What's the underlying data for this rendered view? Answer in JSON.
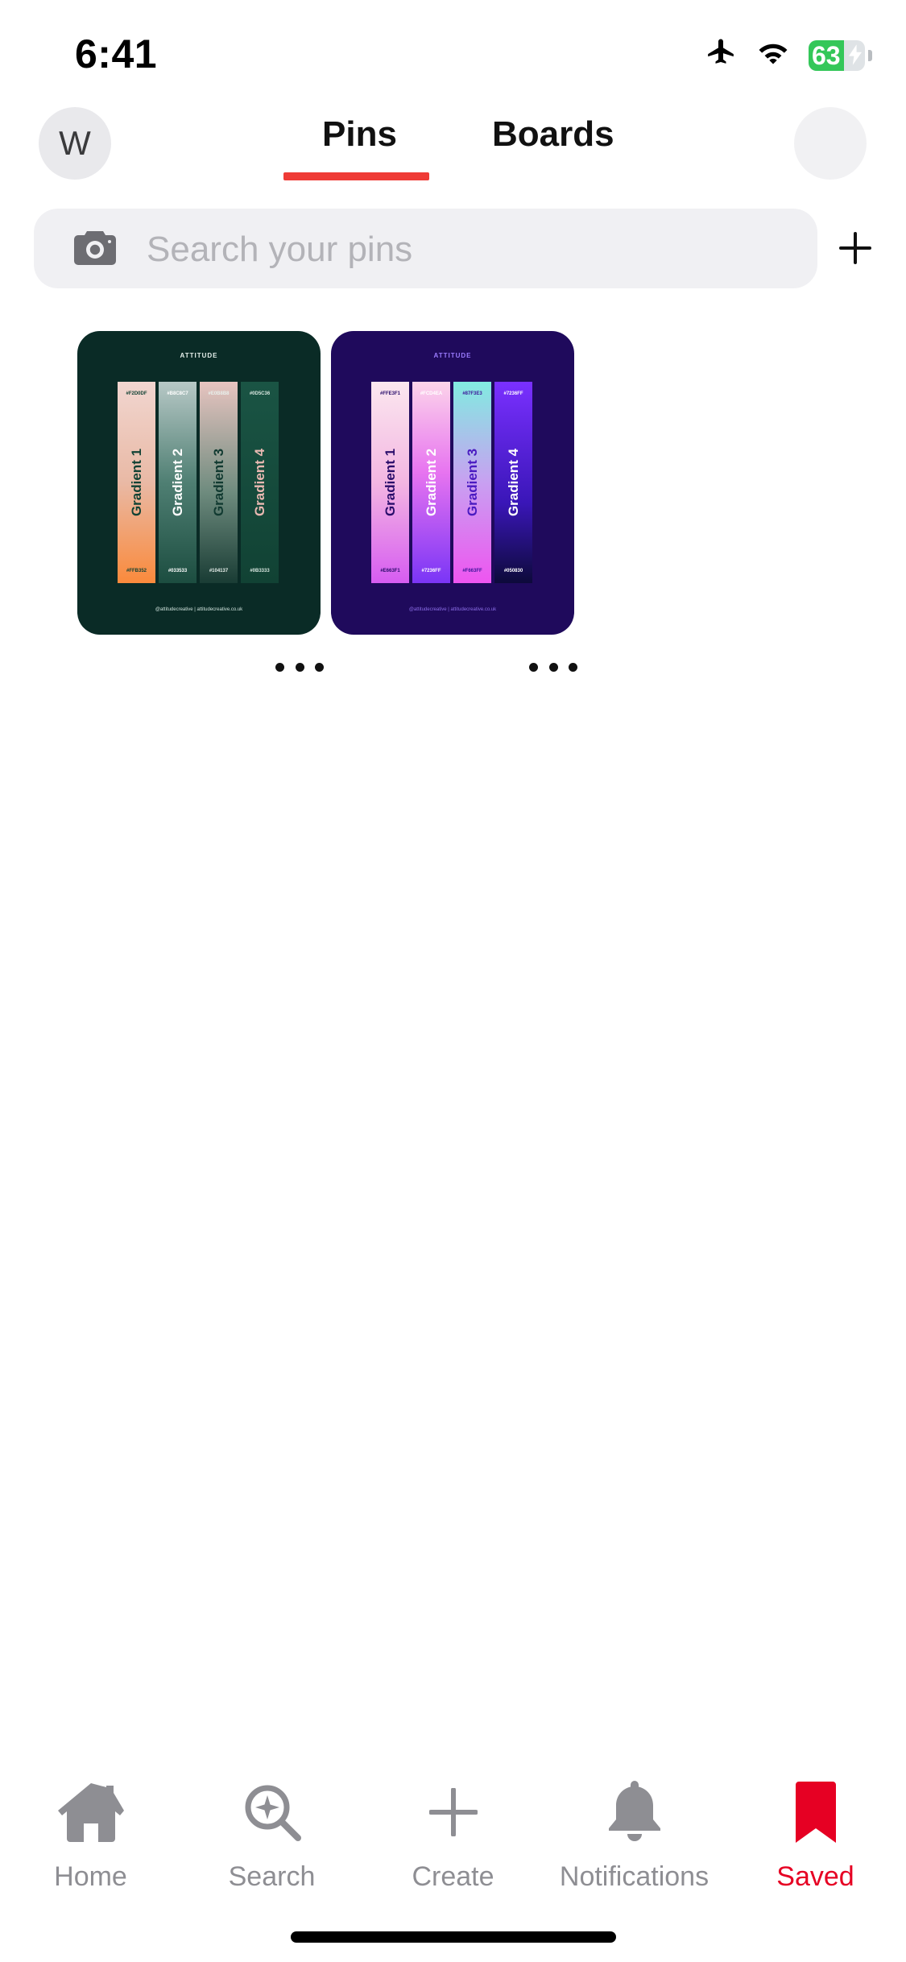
{
  "status_bar": {
    "time": "6:41",
    "battery_level": "63",
    "battery_fraction": 0.63,
    "icons": [
      "airplane-icon",
      "wifi-icon",
      "battery-charging-icon"
    ]
  },
  "header": {
    "avatar_initial": "W",
    "tabs": [
      {
        "label": "Pins",
        "active": true
      },
      {
        "label": "Boards",
        "active": false
      }
    ]
  },
  "search": {
    "placeholder": "Search your pins",
    "value": ""
  },
  "pins": [
    {
      "brand": "ATTITUDE",
      "strips": [
        {
          "label": "Gradient 1",
          "top_code": "#F2D0DF",
          "bottom_code": "#FFB352"
        },
        {
          "label": "Gradient 2",
          "top_code": "#B8C8C7",
          "bottom_code": "#033533"
        },
        {
          "label": "Gradient 3",
          "top_code": "#E0B8B8",
          "bottom_code": "#104137"
        },
        {
          "label": "Gradient 4",
          "top_code": "#0D5C36",
          "bottom_code": "#0B3333"
        }
      ],
      "footer": "@attitudecreative | attitudecreative.co.uk"
    },
    {
      "brand": "ATTITUDE",
      "strips": [
        {
          "label": "Gradient 1",
          "top_code": "#FFE3F1",
          "bottom_code": "#E663F1"
        },
        {
          "label": "Gradient 2",
          "top_code": "#FCD4EA",
          "bottom_code": "#7236FF"
        },
        {
          "label": "Gradient 3",
          "top_code": "#87F3E3",
          "bottom_code": "#F663FF"
        },
        {
          "label": "Gradient 4",
          "top_code": "#7236FF",
          "bottom_code": "#050830"
        }
      ],
      "footer": "@attitudecreative | attitudecreative.co.uk"
    }
  ],
  "bottom_nav": [
    {
      "label": "Home",
      "icon": "home-icon",
      "active": false
    },
    {
      "label": "Search",
      "icon": "search-sparkle-icon",
      "active": false
    },
    {
      "label": "Create",
      "icon": "plus-icon",
      "active": false
    },
    {
      "label": "Notifications",
      "icon": "bell-icon",
      "active": false
    },
    {
      "label": "Saved",
      "icon": "bookmark-icon",
      "active": true
    }
  ],
  "colors": {
    "accent": "#e60023",
    "tab_underline": "#ef3b36",
    "battery_green": "#34c759",
    "inactive_nav": "#8e8e93"
  }
}
